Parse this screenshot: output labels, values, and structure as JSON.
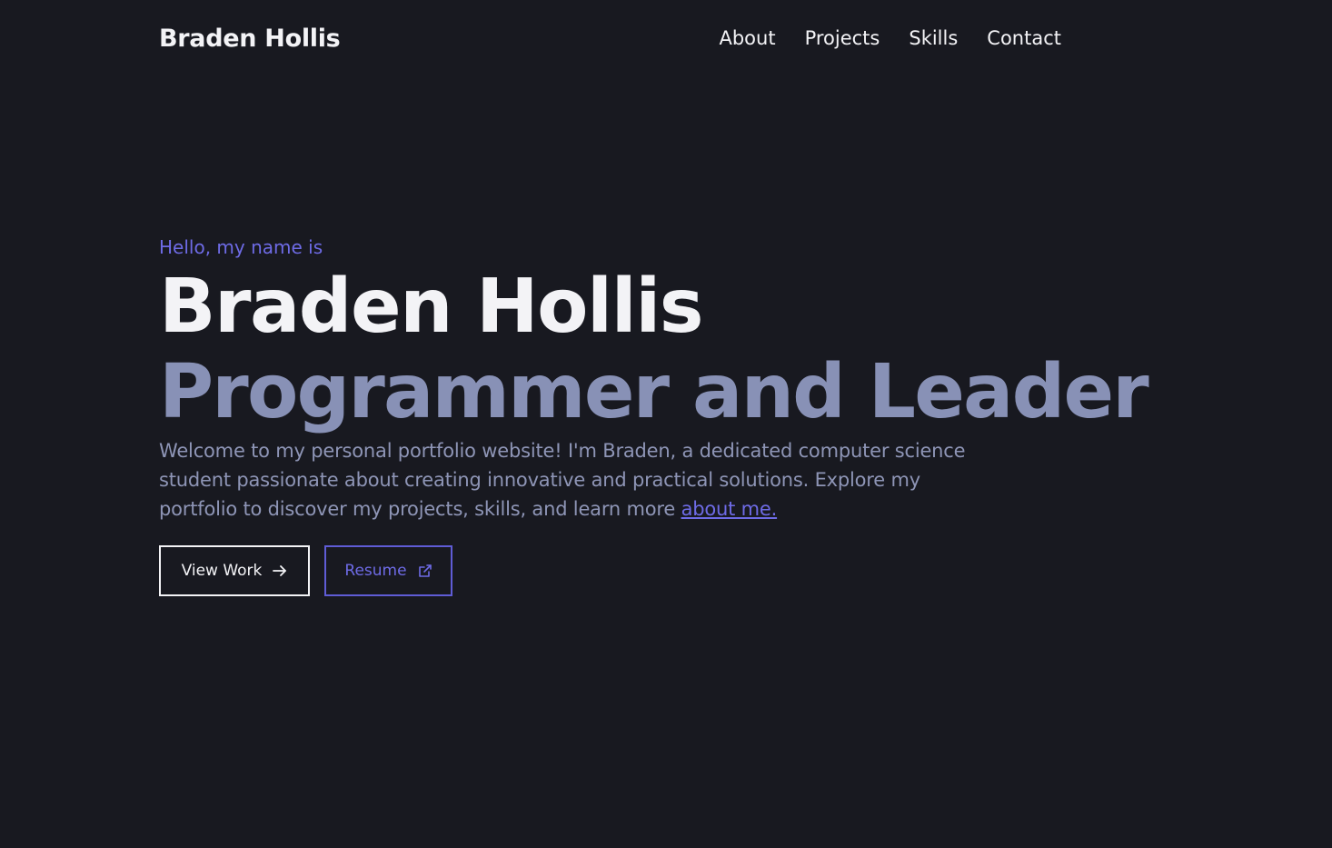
{
  "header": {
    "brand": "Braden Hollis",
    "nav": [
      {
        "label": "About"
      },
      {
        "label": "Projects"
      },
      {
        "label": "Skills"
      },
      {
        "label": "Contact"
      }
    ]
  },
  "hero": {
    "greeting": "Hello, my name is",
    "name": "Braden Hollis",
    "tagline": "Programmer and Leader",
    "intro": "Welcome to my personal portfolio website! I'm Braden, a dedicated computer science student passionate about creating innovative and practical solutions. Explore my portfolio to discover my projects, skills, and learn more ",
    "intro_link": "about me.",
    "buttons": {
      "view_work": "View Work",
      "view_work_icon": "arrow-right-icon",
      "resume": "Resume",
      "resume_icon": "external-link-icon"
    }
  },
  "colors": {
    "background": "#181920",
    "text": "#f3f3f6",
    "accent": "#6e6be6",
    "muted": "#8891b6"
  }
}
